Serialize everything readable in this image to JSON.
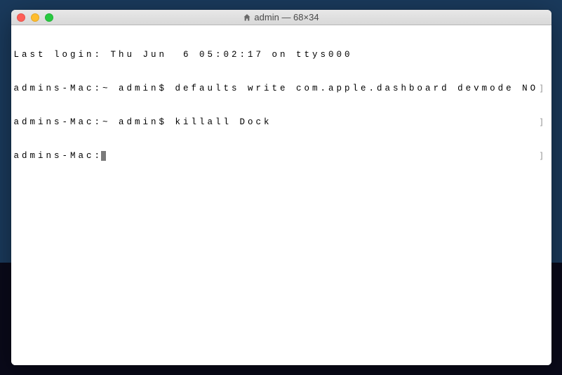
{
  "window": {
    "title": "admin — 68×34"
  },
  "terminal": {
    "lines": [
      {
        "text": "Last login: Thu Jun  6 05:02:17 on ttys000",
        "mark": ""
      },
      {
        "text": "admins-Mac:~ admin$ defaults write com.apple.dashboard devmode NO",
        "mark": "]"
      },
      {
        "text": "admins-Mac:~ admin$ killall Dock",
        "mark": "]"
      },
      {
        "text": "admins-Mac:",
        "mark": "]"
      }
    ],
    "prompt_cursor": true
  }
}
